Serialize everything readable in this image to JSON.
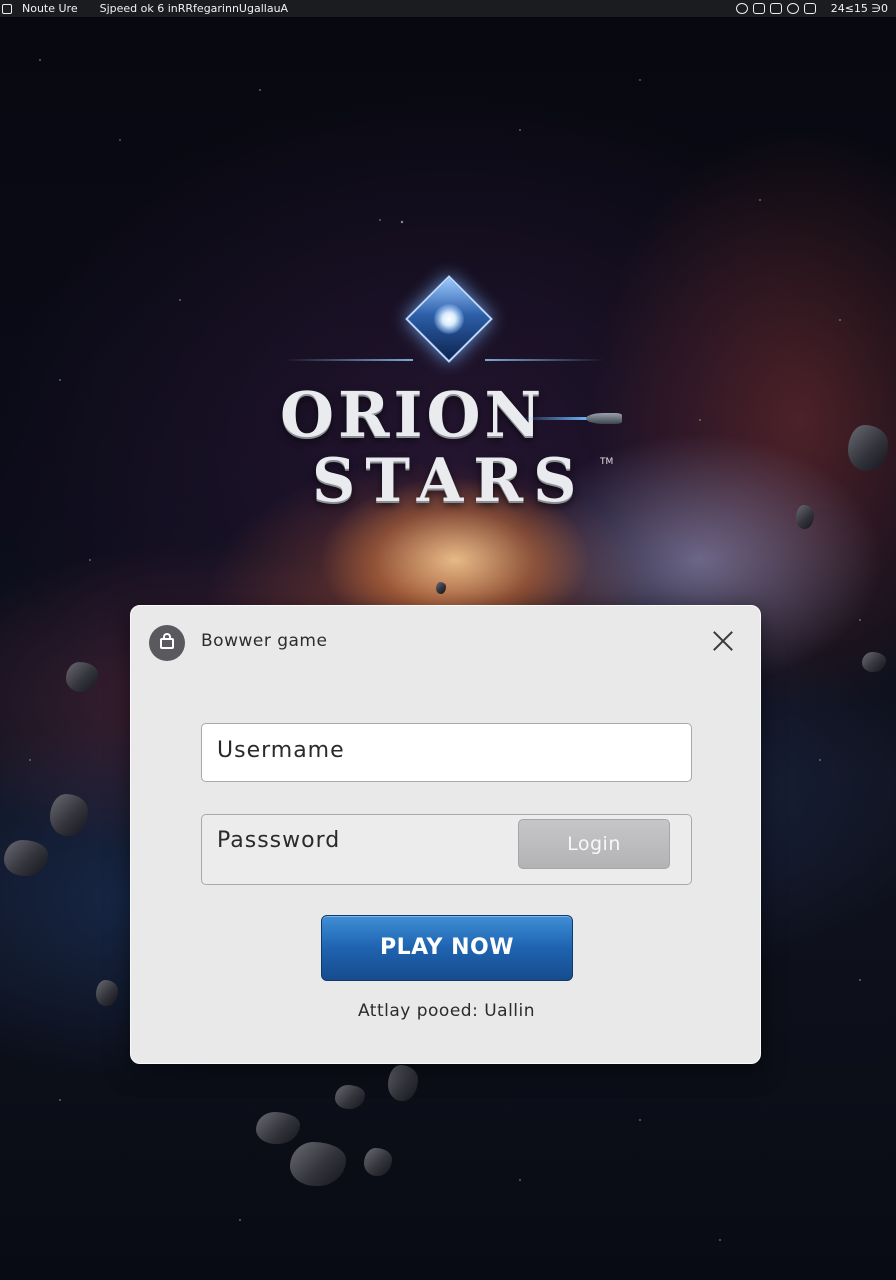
{
  "status_bar": {
    "left_text": "Noute Ure",
    "middle_text": "Sjpeed ok 6 inRRfegarinnUgallauA",
    "time": "24≤15 ∋0"
  },
  "logo": {
    "line1": "ORION",
    "line2": "STARS",
    "trademark": "TM"
  },
  "login_card": {
    "title": "Bowwer game",
    "username_value": "Usermame",
    "password_value": "Passsword",
    "login_label": "Login",
    "play_label": "PLAY NOW",
    "footer_text": "Attlay pooed: Uallin"
  }
}
